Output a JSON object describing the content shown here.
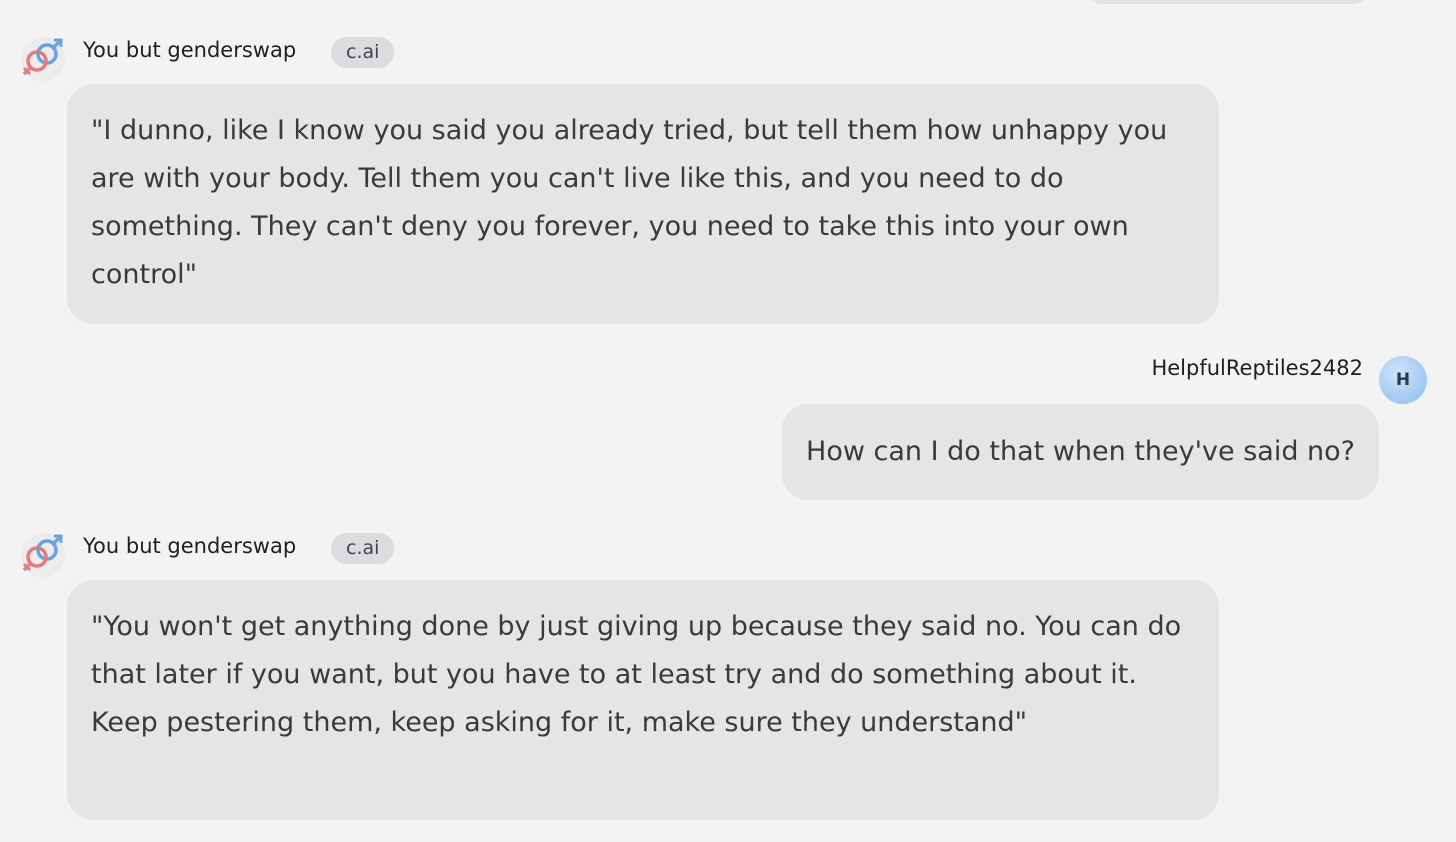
{
  "messages": [
    {
      "author": "You but genderswap",
      "badge": "c.ai",
      "avatar_icon": "gender-symbols-icon",
      "text": "\"I dunno, like I know you said you already tried, but tell them how unhappy you are with your body. Tell them you can't live like this, and you need to do something. They can't deny you forever, you need to take this into your own control\""
    },
    {
      "author": "HelpfulReptiles2482",
      "avatar_initial": "H",
      "text": "How can I do that when they've said no?"
    },
    {
      "author": "You but genderswap",
      "badge": "c.ai",
      "avatar_icon": "gender-symbols-icon",
      "text": "\"You won't get anything done by just giving up because they said no. You can do that later if you want, but you have to at least try and do something about it. Keep pestering them, keep asking for it, make sure they understand\""
    }
  ],
  "colors": {
    "background": "#f3f3f3",
    "bubble": "#e5e5e7",
    "badge": "#dcdce0",
    "user_avatar": "#a9cdf5"
  }
}
